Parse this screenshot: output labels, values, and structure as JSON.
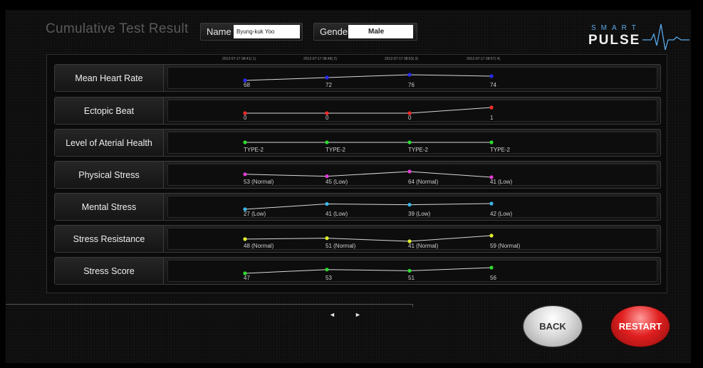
{
  "header": {
    "title": "Cumulative Test Result",
    "name_label": "Name",
    "name_value": "Byung-kuk Yoo",
    "gender_label": "Gender",
    "gender_value": "Male",
    "logo_top": "SMART",
    "logo_bottom": "PULSE"
  },
  "test_dates": [
    "2012-07-17 08:41( 1)",
    "2012-07-17 08:48( 2)",
    "2012-07-17 08:53( 3)",
    "2012-07-17 08:57( 4)"
  ],
  "chart_data": {
    "type": "line",
    "categories": [
      "2012-07-17 08:41( 1)",
      "2012-07-17 08:48( 2)",
      "2012-07-17 08:53( 3)",
      "2012-07-17 08:57( 4)"
    ],
    "series": [
      {
        "name": "Mean Heart Rate",
        "color": "#2a2aff",
        "values": [
          68,
          72,
          76,
          74
        ],
        "labels": [
          "68",
          "72",
          "76",
          "74"
        ]
      },
      {
        "name": "Ectopic Beat",
        "color": "#ff2a2a",
        "values": [
          0,
          0,
          0,
          1
        ],
        "labels": [
          "0",
          "0",
          "0",
          "1"
        ]
      },
      {
        "name": "Level of Aterial Health",
        "color": "#2ddc2d",
        "values": [
          2,
          2,
          2,
          2
        ],
        "labels": [
          "TYPE-2",
          "TYPE-2",
          "TYPE-2",
          "TYPE-2"
        ]
      },
      {
        "name": "Physical Stress",
        "color": "#e23bd6",
        "values": [
          53,
          45,
          64,
          41
        ],
        "labels": [
          "53 (Normal)",
          "45 (Low)",
          "64 (Normal)",
          "41 (Low)"
        ]
      },
      {
        "name": "Mental Stress",
        "color": "#3ab6ea",
        "values": [
          27,
          41,
          39,
          42
        ],
        "labels": [
          "27 (Low)",
          "41 (Low)",
          "39 (Low)",
          "42 (Low)"
        ]
      },
      {
        "name": "Stress Resistance",
        "color": "#e4f02a",
        "values": [
          48,
          51,
          41,
          59
        ],
        "labels": [
          "48 (Normal)",
          "51 (Normal)",
          "41 (Normal)",
          "59 (Normal)"
        ]
      },
      {
        "name": "Stress Score",
        "color": "#2ddc2d",
        "values": [
          47,
          53,
          51,
          56
        ],
        "labels": [
          "47",
          "53",
          "51",
          "56"
        ]
      }
    ]
  },
  "nav": {
    "prev": "◄",
    "next": "►"
  },
  "buttons": {
    "back": "BACK",
    "restart": "RESTART"
  }
}
